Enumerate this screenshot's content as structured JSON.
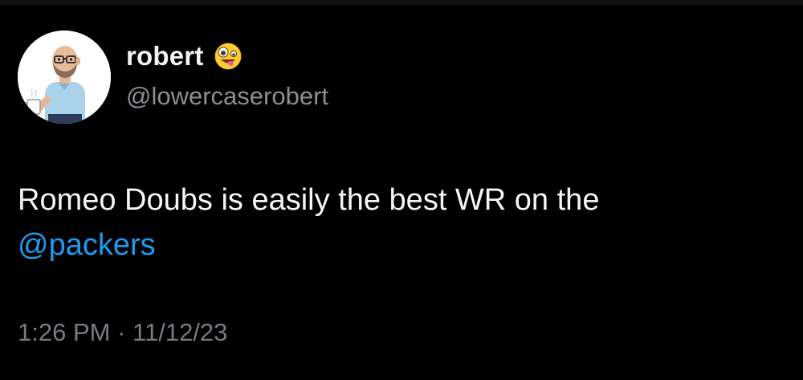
{
  "user": {
    "display_name": "robert",
    "handle": "@lowercaserobert",
    "name_emoji": "zany-face-emoji",
    "avatar_icon": "bitmoji-avatar-with-mug"
  },
  "tweet": {
    "text_before": "Romeo Doubs is easily the best WR on the",
    "mention": "@packers"
  },
  "meta": {
    "time": "1:26 PM",
    "separator": "·",
    "date": "11/12/23"
  },
  "colors": {
    "background": "#000000",
    "text": "#f5f5f5",
    "secondary": "#8b8f94",
    "link": "#1d9bf0"
  }
}
